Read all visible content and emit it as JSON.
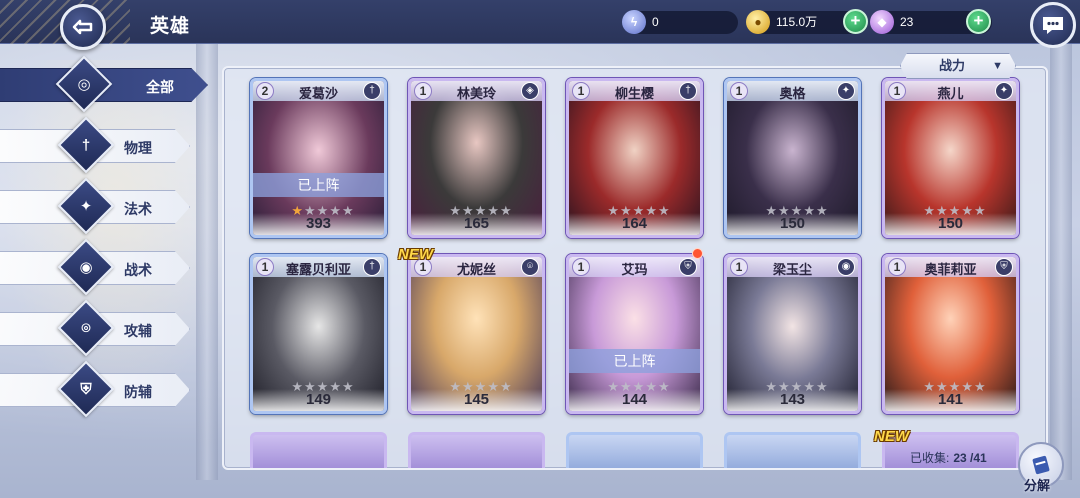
{
  "header": {
    "title": "英雄",
    "resources": [
      {
        "icon": "lightning-coin-icon",
        "value": "0"
      },
      {
        "icon": "gold-coin-icon",
        "value": "115.0万"
      },
      {
        "icon": "purple-gem-icon",
        "value": "23"
      }
    ]
  },
  "tabs": [
    {
      "label": "全部",
      "icon": "all-icon",
      "active": true
    },
    {
      "label": "物理",
      "icon": "sword-icon",
      "active": false
    },
    {
      "label": "法术",
      "icon": "magic-icon",
      "active": false
    },
    {
      "label": "战术",
      "icon": "eye-icon",
      "active": false
    },
    {
      "label": "攻辅",
      "icon": "attack-support-icon",
      "active": false
    },
    {
      "label": "防辅",
      "icon": "shield-icon",
      "active": false
    }
  ],
  "sort": {
    "label": "战力"
  },
  "heroes": [
    {
      "level": "2",
      "name": "爱葛沙",
      "power": "393",
      "stars_lit": 1,
      "deployed": "已上阵",
      "frame": "blue"
    },
    {
      "level": "1",
      "name": "林美玲",
      "power": "165",
      "stars_lit": 0,
      "frame": "purple"
    },
    {
      "level": "1",
      "name": "柳生樱",
      "power": "164",
      "stars_lit": 0,
      "frame": "purple"
    },
    {
      "level": "1",
      "name": "奥格",
      "power": "150",
      "stars_lit": 0,
      "frame": "blue"
    },
    {
      "level": "1",
      "name": "燕儿",
      "power": "150",
      "stars_lit": 0,
      "frame": "purple"
    },
    {
      "level": "1",
      "name": "塞露贝利亚",
      "power": "149",
      "stars_lit": 0,
      "frame": "blue"
    },
    {
      "level": "1",
      "name": "尤妮丝",
      "power": "145",
      "stars_lit": 0,
      "frame": "purple",
      "new": "NEW"
    },
    {
      "level": "1",
      "name": "艾玛",
      "power": "144",
      "stars_lit": 0,
      "deployed": "已上阵",
      "frame": "purple",
      "dot": true
    },
    {
      "level": "1",
      "name": "梁玉尘",
      "power": "143",
      "stars_lit": 0,
      "frame": "purple"
    },
    {
      "level": "1",
      "name": "奥菲莉亚",
      "power": "141",
      "stars_lit": 0,
      "frame": "purple"
    }
  ],
  "bottom_new": "NEW",
  "collection": {
    "label": "已收集:",
    "value": "23 /41"
  },
  "dismantle": {
    "label": "分解"
  }
}
